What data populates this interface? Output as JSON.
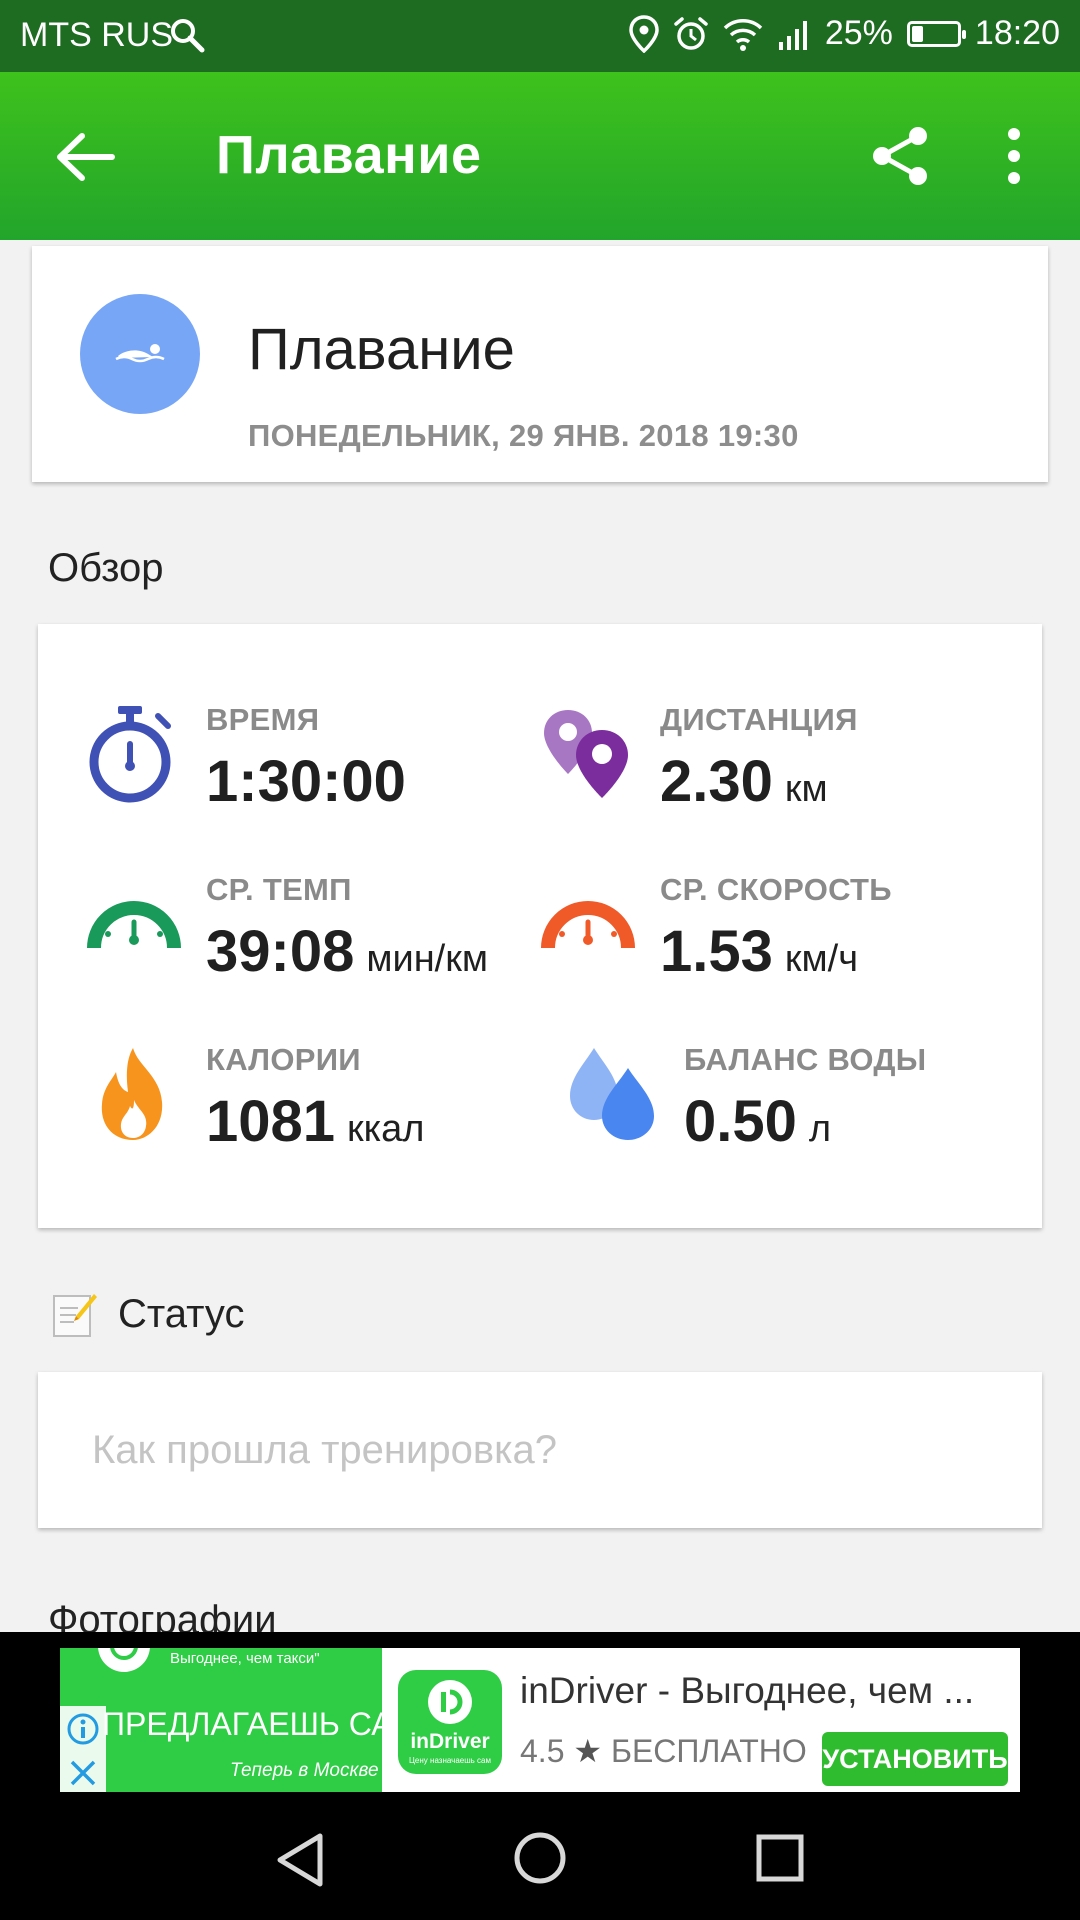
{
  "status_bar": {
    "carrier": "MTS RUS",
    "battery": "25%",
    "battery_level": 0.25,
    "time": "18:20"
  },
  "app_bar": {
    "title": "Плавание"
  },
  "activity": {
    "name": "Плавание",
    "datetime": "ПОНЕДЕЛЬНИК, 29 ЯНВ. 2018 19:30",
    "avatar_color": "#78a6f7"
  },
  "overview": {
    "title": "Обзор",
    "time": {
      "label": "ВРЕМЯ",
      "value": "1:30:00",
      "unit": ""
    },
    "distance": {
      "label": "ДИСТАНЦИЯ",
      "value": "2.30",
      "unit": "км"
    },
    "pace": {
      "label": "СР. ТЕМП",
      "value": "39:08",
      "unit": "мин/км"
    },
    "speed": {
      "label": "СР. СКОРОСТЬ",
      "value": "1.53",
      "unit": "км/ч"
    },
    "calories": {
      "label": "КАЛОРИИ",
      "value": "1081",
      "unit": "ккал"
    },
    "water": {
      "label": "БАЛАНС ВОДЫ",
      "value": "0.50",
      "unit": "л"
    }
  },
  "status": {
    "title": "Статус",
    "placeholder": "Как прошла тренировка?"
  },
  "photos": {
    "title": "Фотографии"
  },
  "ad": {
    "image_top_text": "Выгоднее, чем такси\"",
    "image_main_text": "ПРЕДЛАГАЕШЬ СА",
    "image_sub_text": "Теперь в Москве",
    "logo_text": "inDriver",
    "logo_tagline": "Цену назначаешь сам",
    "title": "inDriver - Выгоднее, чем ...",
    "rating": "4.5",
    "price": "БЕСПЛАТНО",
    "install_label": "УСТАНОВИТЬ",
    "brand_color": "#2fcc45"
  }
}
